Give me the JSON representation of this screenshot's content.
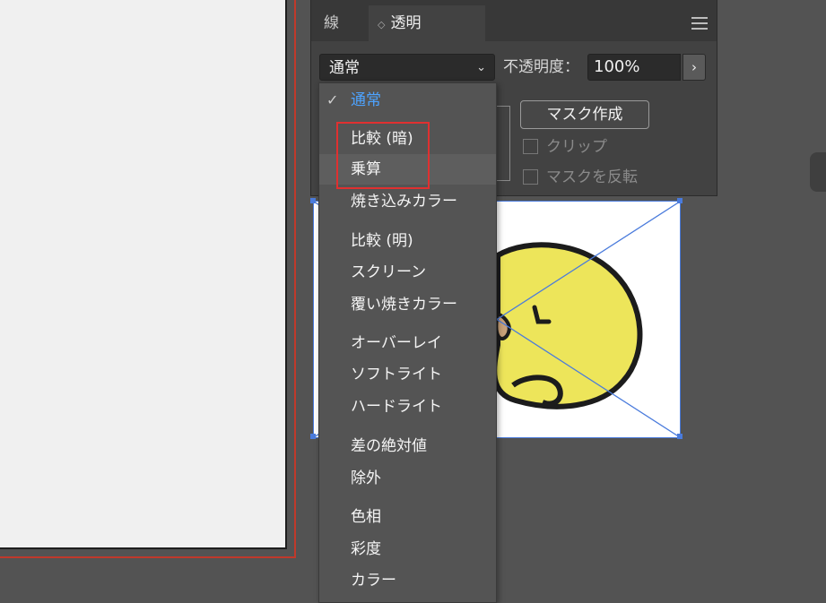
{
  "panel": {
    "tabs": [
      {
        "label": "線"
      },
      {
        "label": "透明",
        "chevron": "◇"
      }
    ],
    "blend_mode": "通常",
    "opacity_label": "不透明度：",
    "opacity_value": "100%",
    "stepper_glyph": "›",
    "mask_button": "マスク作成",
    "clip_label": "クリップ",
    "invert_label": "マスクを反転"
  },
  "dropdown": {
    "check": "✓",
    "options": [
      {
        "label": "通常",
        "selected": true
      },
      {
        "label": "比較 (暗)"
      },
      {
        "label": "乗算",
        "hover": true
      },
      {
        "label": "焼き込みカラー"
      },
      {
        "label": "比較 (明)"
      },
      {
        "label": "スクリーン"
      },
      {
        "label": "覆い焼きカラー"
      },
      {
        "label": "オーバーレイ"
      },
      {
        "label": "ソフトライト"
      },
      {
        "label": "ハードライト"
      },
      {
        "label": "差の絶対値"
      },
      {
        "label": "除外"
      },
      {
        "label": "色相"
      },
      {
        "label": "彩度"
      },
      {
        "label": "カラー"
      }
    ]
  },
  "colors": {
    "selected_text": "#4da3ff",
    "highlight_frame": "#e03030",
    "bounding_box": "#4a7bdc",
    "illustration_fill": "#ede55a"
  }
}
